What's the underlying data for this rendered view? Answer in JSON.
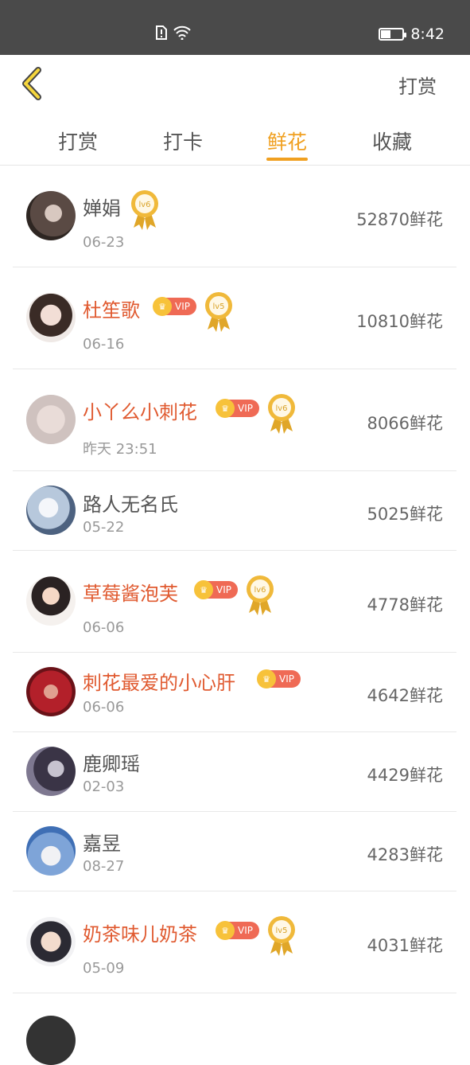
{
  "status_bar": {
    "time": "8:42"
  },
  "header": {
    "back_icon": "chevron-left-icon",
    "right_action": "打赏"
  },
  "tabs": [
    {
      "label": "打赏",
      "active": false
    },
    {
      "label": "打卡",
      "active": false
    },
    {
      "label": "鲜花",
      "active": true
    },
    {
      "label": "收藏",
      "active": false
    }
  ],
  "list": [
    {
      "name": "婵娟",
      "date": "06-23",
      "amount": "52870鲜花",
      "vip": false,
      "level": "lv6"
    },
    {
      "name": "杜笙歌",
      "date": "06-16",
      "amount": "10810鲜花",
      "vip": true,
      "vip_label": "VIP",
      "level": "lv5"
    },
    {
      "name": "小丫么小刺花",
      "date": "昨天 23:51",
      "amount": "8066鲜花",
      "vip": true,
      "vip_label": "VIP",
      "level": "lv6"
    },
    {
      "name": "路人无名氏",
      "date": "05-22",
      "amount": "5025鲜花",
      "vip": false,
      "level": ""
    },
    {
      "name": "草莓酱泡芙",
      "date": "06-06",
      "amount": "4778鲜花",
      "vip": true,
      "vip_label": "VIP",
      "level": "lv6"
    },
    {
      "name": "刺花最爱的小心肝",
      "date": "06-06",
      "amount": "4642鲜花",
      "vip": true,
      "vip_label": "VIP",
      "level": ""
    },
    {
      "name": "鹿卿瑶",
      "date": "02-03",
      "amount": "4429鲜花",
      "vip": false,
      "level": ""
    },
    {
      "name": "嘉昱",
      "date": "08-27",
      "amount": "4283鲜花",
      "vip": false,
      "level": ""
    },
    {
      "name": "奶茶味儿奶茶",
      "date": "05-09",
      "amount": "4031鲜花",
      "vip": true,
      "vip_label": "VIP",
      "level": "lv5"
    }
  ],
  "colors": {
    "accent": "#f0a020",
    "vip_name": "#e05a30",
    "vip_badge": "#ef6a55",
    "status_bar": "#4a4a4a"
  }
}
